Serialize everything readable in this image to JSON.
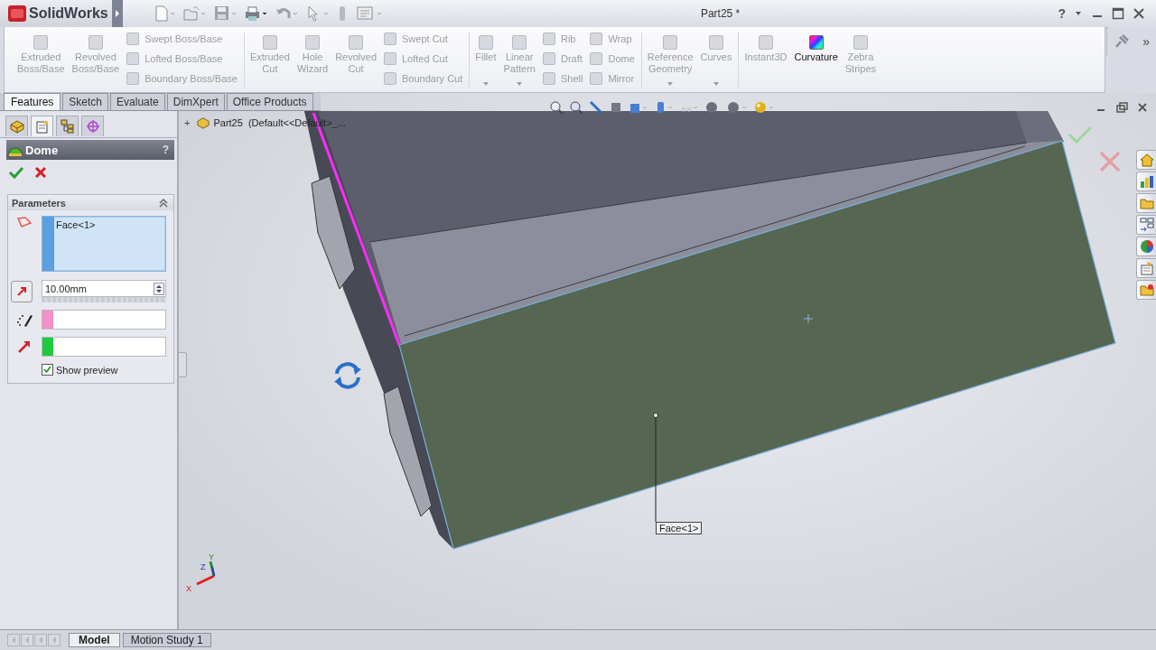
{
  "title_bar": {
    "logo": "SolidWorks",
    "title": "Part25 *",
    "help": "?"
  },
  "ribbon": {
    "overflow": "»",
    "groups": [
      {
        "columns": [
          {
            "kind": "large",
            "label": "Extruded Boss/Base",
            "enabled": false,
            "dropdown": false
          },
          {
            "kind": "large",
            "label": "Revolved Boss/Base",
            "enabled": false,
            "dropdown": false
          },
          {
            "kind": "stack",
            "items": [
              {
                "label": "Swept Boss/Base",
                "enabled": false
              },
              {
                "label": "Lofted Boss/Base",
                "enabled": false
              },
              {
                "label": "Boundary Boss/Base",
                "enabled": false
              }
            ]
          }
        ]
      },
      {
        "columns": [
          {
            "kind": "large",
            "label": "Extruded Cut",
            "enabled": false,
            "dropdown": false
          },
          {
            "kind": "large",
            "label": "Hole Wizard",
            "enabled": false,
            "dropdown": false
          },
          {
            "kind": "large",
            "label": "Revolved Cut",
            "enabled": false,
            "dropdown": false
          },
          {
            "kind": "stack",
            "items": [
              {
                "label": "Swept Cut",
                "enabled": false
              },
              {
                "label": "Lofted Cut",
                "enabled": false
              },
              {
                "label": "Boundary Cut",
                "enabled": false
              }
            ]
          }
        ]
      },
      {
        "columns": [
          {
            "kind": "large",
            "label": "Fillet",
            "enabled": false,
            "dropdown": true
          },
          {
            "kind": "large",
            "label": "Linear Pattern",
            "enabled": false,
            "dropdown": true
          },
          {
            "kind": "stack",
            "items": [
              {
                "label": "Rib",
                "enabled": false
              },
              {
                "label": "Draft",
                "enabled": false
              },
              {
                "label": "Shell",
                "enabled": false
              }
            ]
          },
          {
            "kind": "stack",
            "items": [
              {
                "label": "Wrap",
                "enabled": false
              },
              {
                "label": "Dome",
                "enabled": false
              },
              {
                "label": "Mirror",
                "enabled": false
              }
            ]
          }
        ]
      },
      {
        "columns": [
          {
            "kind": "large",
            "label": "Reference Geometry",
            "enabled": false,
            "dropdown": true
          },
          {
            "kind": "large",
            "label": "Curves",
            "enabled": false,
            "dropdown": true
          }
        ]
      },
      {
        "columns": [
          {
            "kind": "large",
            "label": "Instant3D",
            "enabled": false,
            "dropdown": false
          },
          {
            "kind": "large",
            "label": "Curvature",
            "enabled": true,
            "dropdown": false
          },
          {
            "kind": "large",
            "label": "Zebra Stripes",
            "enabled": false,
            "dropdown": false
          }
        ]
      }
    ]
  },
  "command_tabs": [
    {
      "label": "Features",
      "selected": true
    },
    {
      "label": "Sketch",
      "selected": false
    },
    {
      "label": "Evaluate",
      "selected": false
    },
    {
      "label": "DimXpert",
      "selected": false
    },
    {
      "label": "Office Products",
      "selected": false
    }
  ],
  "panel_tabs": [
    {
      "kind": "feature-tree",
      "selected": false
    },
    {
      "kind": "property-manager",
      "selected": true
    },
    {
      "kind": "configuration-manager",
      "selected": false
    },
    {
      "kind": "dimxpert-manager",
      "selected": false
    }
  ],
  "property_manager": {
    "title": "Dome",
    "help": "?",
    "group": {
      "title": "Parameters",
      "expanded": true,
      "faces": [
        "Face<1>"
      ],
      "distance": "10.00mm",
      "color_fields": [
        {
          "color": "#f590c8"
        },
        {
          "color": "#1ecb3c"
        }
      ],
      "show_preview": {
        "label": "Show preview",
        "checked": true
      }
    }
  },
  "feature_tree": {
    "expander": "+",
    "label": "Part25  (Default<<Default>_..."
  },
  "viewport": {
    "callout": "Face<1>",
    "triad": {
      "x": "X",
      "y": "Y",
      "z": "Z"
    }
  },
  "bottom_tabs": [
    {
      "label": "Model",
      "selected": true
    },
    {
      "label": "Motion Study 1",
      "selected": false
    }
  ]
}
